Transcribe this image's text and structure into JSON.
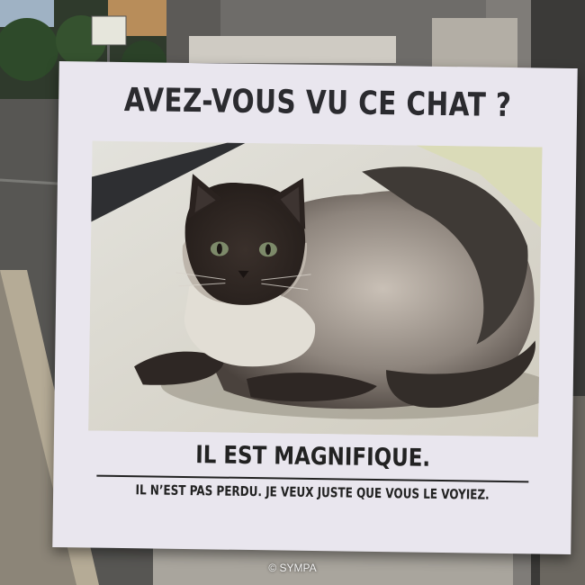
{
  "poster": {
    "headline": "AVEZ-VOUS VU CE CHAT ?",
    "subheadline": "IL EST MAGNIFIQUE.",
    "footnote": "IL N’EST PAS PERDU. JE VEUX JUSTE QUE VOUS LE VOYIEZ."
  },
  "credit": "© SYMPA",
  "colors": {
    "poster_paper": "#e9e6ee",
    "ink": "#2b2b2f",
    "cat_fur_light": "#cfc6bb",
    "cat_points_dark": "#3e3530",
    "cat_eyes": "#7d8a6a"
  }
}
